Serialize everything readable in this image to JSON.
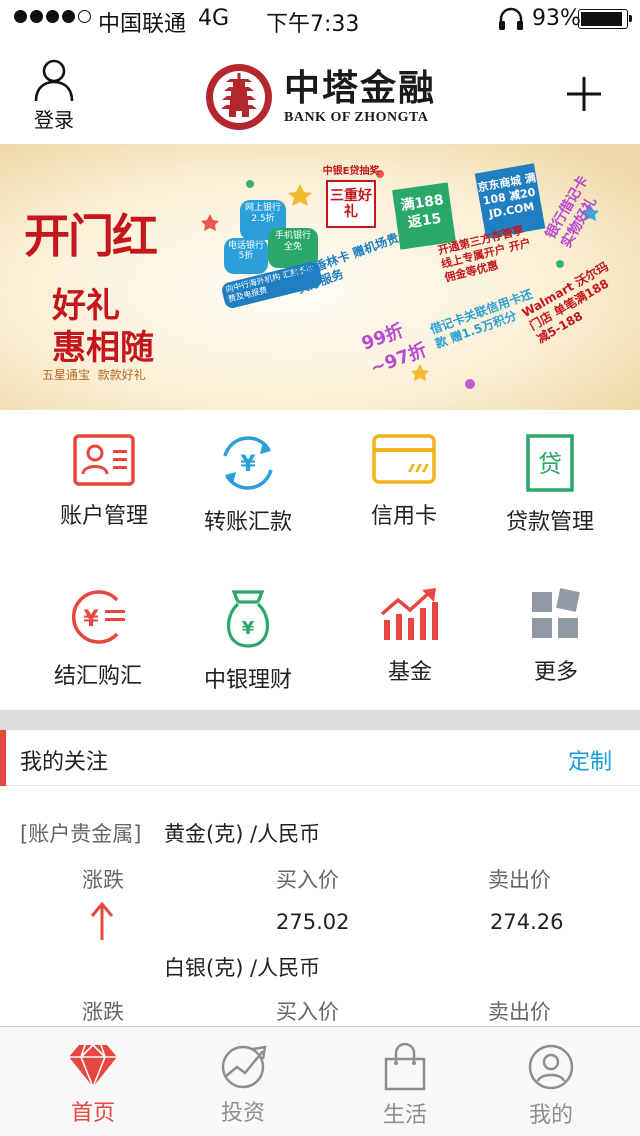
{
  "status_bar": {
    "carrier": "中国联通",
    "network": "4G",
    "time": "下午7:33",
    "battery": "93%",
    "signal_bars": 4,
    "battery_level": 0.93
  },
  "header": {
    "login_label": "登录",
    "brand_cn": "中塔金融",
    "brand_en": "BANK OF ZHONGTA"
  },
  "banner": {
    "title": "开门红",
    "subtitle_1": "好礼",
    "subtitle_2": "惠相随",
    "tagline": "五星通宝  款款好礼",
    "tags": [
      "网上银行 2.5折",
      "手机银行 全免",
      "电话银行 5折",
      "向中行海外机构 汇款手续费及电报费",
      "中银E贷抽奖",
      "三重好礼",
      "满188 返15",
      "京东商城 满108 减20 JD.COM",
      "长城香林卡 赠机场贵宾厅服务",
      "99折~97折",
      "开通第三方存管享 线上专属开户 开户佣金等优惠",
      "银行借记卡 实物好礼",
      "借记卡关联信用卡还款 赠1.5万积分",
      "Walmart 沃尔玛门店 单笔满188 减5-188"
    ]
  },
  "grid": [
    {
      "label": "账户管理",
      "icon": "account-card-icon"
    },
    {
      "label": "转账汇款",
      "icon": "transfer-yuan-icon"
    },
    {
      "label": "信用卡",
      "icon": "credit-card-icon"
    },
    {
      "label": "贷款管理",
      "icon": "loan-icon"
    },
    {
      "label": "结汇购汇",
      "icon": "exchange-yuan-icon"
    },
    {
      "label": "中银理财",
      "icon": "money-bag-icon"
    },
    {
      "label": "基金",
      "icon": "fund-chart-icon"
    },
    {
      "label": "更多",
      "icon": "more-tiles-icon"
    }
  ],
  "follow": {
    "title": "我的关注",
    "custom_label": "定制",
    "category": "[账户贵金属]",
    "items": [
      {
        "name": "黄金(克) /人民币",
        "change_label": "涨跌",
        "buy_label": "买入价",
        "sell_label": "卖出价",
        "buy_price": "275.02",
        "sell_price": "274.26",
        "trend": "up"
      },
      {
        "name": "白银(克) /人民币",
        "change_label": "涨跌",
        "buy_label": "买入价",
        "sell_label": "卖出价"
      }
    ]
  },
  "tabs": [
    {
      "label": "首页",
      "icon": "diamond-icon",
      "active": true
    },
    {
      "label": "投资",
      "icon": "investment-chart-icon",
      "active": false
    },
    {
      "label": "生活",
      "icon": "shopping-bag-icon",
      "active": false
    },
    {
      "label": "我的",
      "icon": "profile-icon",
      "active": false
    }
  ],
  "colors": {
    "accent_red": "#e8473f",
    "accent_blue": "#1a9be0",
    "account_icon": "#e8473f",
    "transfer_icon": "#2a9fd8",
    "credit_icon": "#f2b31c",
    "loan_icon": "#2aa86a",
    "exchange_icon": "#e8473f",
    "wealth_icon": "#2aa86a",
    "fund_icon": "#e8473f",
    "more_icon": "#8f9aa5"
  }
}
